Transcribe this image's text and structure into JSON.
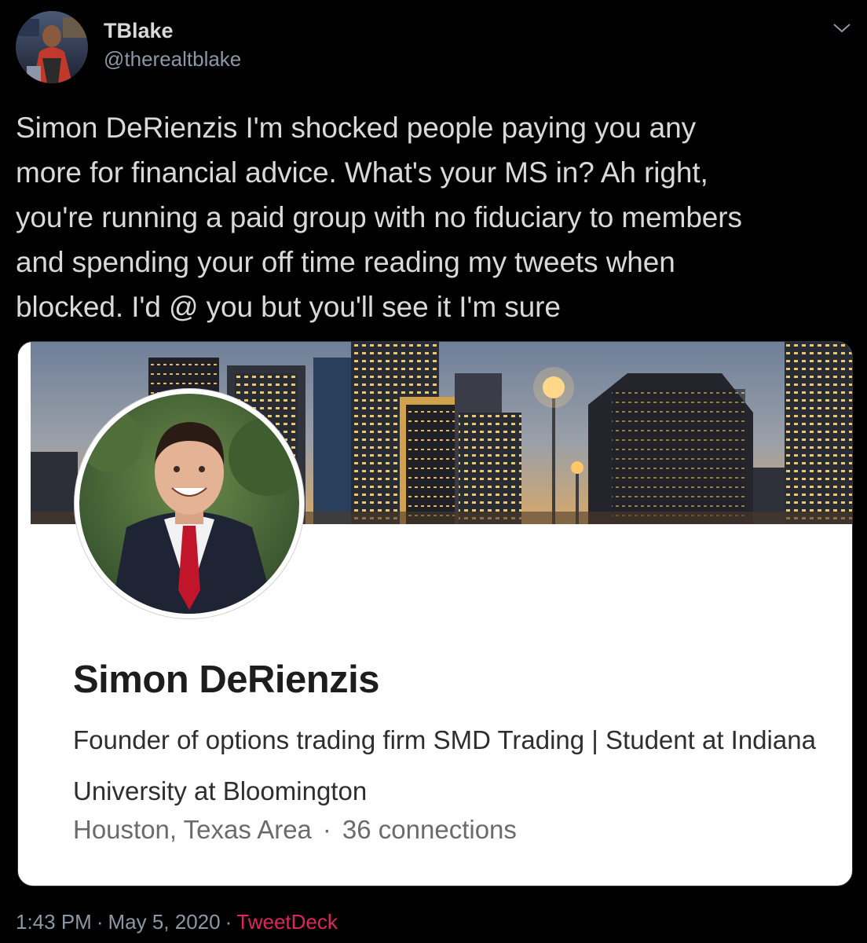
{
  "author": {
    "name": "TBlake",
    "handle": "@therealtblake"
  },
  "tweet": {
    "text": "Simon DeRienzis I'm shocked people paying you any\nmore for financial advice. What's your MS in? Ah right,\nyou're running a paid group with no fiduciary to members\nand spending your off time reading my tweets when\nblocked. I'd @ you but you'll see it I'm sure"
  },
  "profile_card": {
    "name": "Simon DeRienzis",
    "headline": "Founder of options trading firm SMD Trading | Student at Indiana University at Bloomington",
    "location": "Houston, Texas Area",
    "separator": "·",
    "connections": "36 connections"
  },
  "meta": {
    "time": "1:43 PM",
    "separator": "·",
    "date": "May 5, 2020",
    "client": "TweetDeck"
  },
  "colors": {
    "background": "#000000",
    "text": "#d9d9d9",
    "muted": "#8b98a5",
    "client_link": "#e0245e"
  },
  "icons": {
    "caret": "chevron-down-icon"
  }
}
